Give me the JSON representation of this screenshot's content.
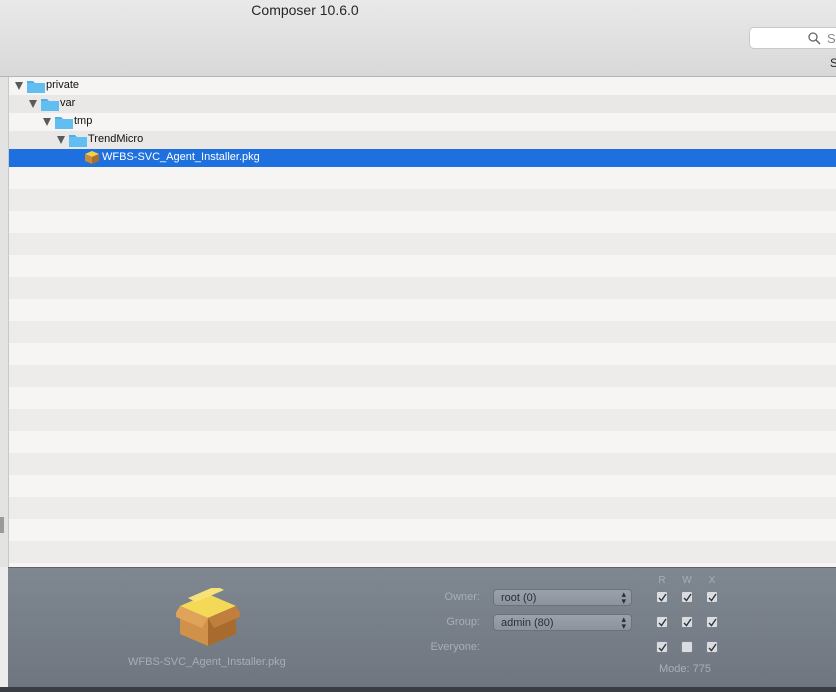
{
  "window": {
    "title": "Composer 10.6.0"
  },
  "toolbar": {
    "search_placeholder": "S",
    "search_label": "S"
  },
  "tree": {
    "rows": [
      {
        "label": "private",
        "expanded": true,
        "type": "folder",
        "depth": 0
      },
      {
        "label": "var",
        "expanded": true,
        "type": "folder",
        "depth": 1
      },
      {
        "label": "tmp",
        "expanded": true,
        "type": "folder",
        "depth": 2
      },
      {
        "label": "TrendMicro",
        "expanded": true,
        "type": "folder",
        "depth": 3
      },
      {
        "label": "WFBS-SVC_Agent_Installer.pkg",
        "type": "package",
        "depth": 4,
        "selected": true
      }
    ]
  },
  "inspector": {
    "package_name": "WFBS-SVC_Agent_Installer.pkg",
    "owner_label": "Owner:",
    "owner_value": "root (0)",
    "group_label": "Group:",
    "group_value": "admin (80)",
    "everyone_label": "Everyone:",
    "perm_headers": [
      "R",
      "W",
      "X"
    ],
    "permissions": {
      "owner": [
        true,
        true,
        true
      ],
      "group": [
        true,
        true,
        true
      ],
      "everyone": [
        true,
        false,
        true
      ]
    },
    "mode": "Mode: 775"
  },
  "colors": {
    "selection": "#1d70dd",
    "folder": "#4fb0e8",
    "inspector_bg": "#767d87"
  },
  "icons": {
    "search": "magnifier-icon",
    "folder": "folder-icon",
    "package": "package-box-icon",
    "disclosure": "disclosure-triangle-icon",
    "popup": "popup-arrows-icon",
    "check": "checkmark-icon"
  }
}
